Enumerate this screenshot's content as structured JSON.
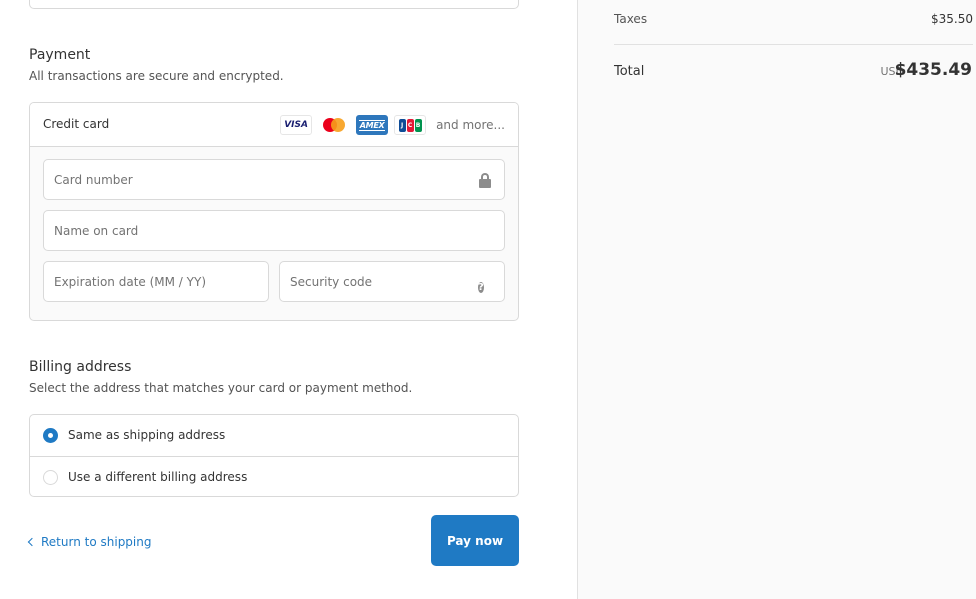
{
  "payment": {
    "title": "Payment",
    "subtitle": "All transactions are secure and encrypted.",
    "method_label": "Credit card",
    "card_brands": [
      "VISA",
      "Mastercard",
      "AMEX",
      "JCB"
    ],
    "and_more": "and more...",
    "fields": {
      "card_number_placeholder": "Card number",
      "name_placeholder": "Name on card",
      "expiry_placeholder": "Expiration date (MM / YY)",
      "security_placeholder": "Security code"
    }
  },
  "billing": {
    "title": "Billing address",
    "subtitle": "Select the address that matches your card or payment method.",
    "options": [
      {
        "label": "Same as shipping address",
        "selected": true
      },
      {
        "label": "Use a different billing address",
        "selected": false
      }
    ]
  },
  "footer": {
    "return_label": "Return to shipping",
    "pay_label": "Pay now"
  },
  "summary": {
    "taxes_label": "Taxes",
    "taxes_value": "$35.50",
    "total_label": "Total",
    "currency": "USD",
    "total_value": "$435.49"
  },
  "colors": {
    "accent": "#1f7ac4",
    "sidebar_bg": "#fafafa",
    "border": "#d9d9d9"
  }
}
